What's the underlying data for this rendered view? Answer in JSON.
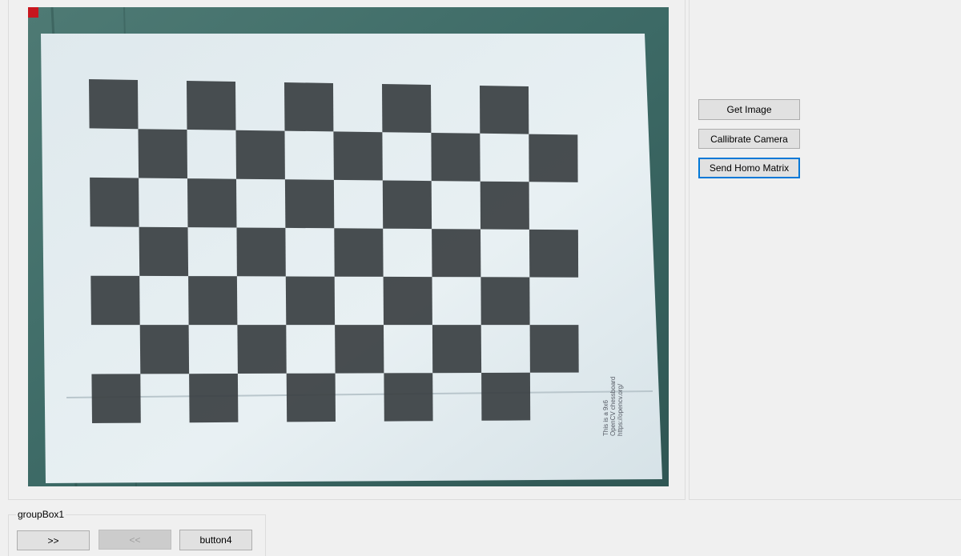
{
  "image_panel": {
    "corner_marker_color": "#c8161e",
    "photo": {
      "subject": "printed chessboard calibration pattern",
      "board_text": [
        "This is a 9x6",
        "OpenCV chessboard",
        "https://opencv.org/"
      ]
    }
  },
  "side_panel": {
    "buttons": {
      "get_image": "Get Image",
      "calibrate": "Callibrate Camera",
      "send_homo": "Send Homo Matrix"
    }
  },
  "group_box": {
    "title": "groupBox1",
    "buttons": {
      "next": ">>",
      "prev": "<<",
      "button4": "button4"
    }
  },
  "colors": {
    "focus_border": "#0078d7",
    "button_bg": "#e1e1e1",
    "window_bg": "#f0f0f0"
  }
}
